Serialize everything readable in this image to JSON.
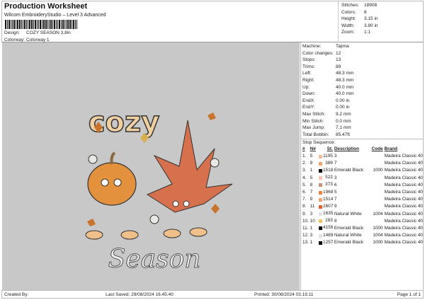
{
  "header": {
    "title": "Production Worksheet",
    "subtitle": "Wilcom EmbroideryStudio – Level 3 Advanced",
    "design_label": "Design:",
    "design_value": "COZY SEASON 3,8in",
    "colorway_label": "Colorway:",
    "colorway_value": "Colorway 1"
  },
  "stats": [
    {
      "k": "Stitches:",
      "v": "18908"
    },
    {
      "k": "Colors:",
      "v": "8"
    },
    {
      "k": "Height:",
      "v": "3.15 in"
    },
    {
      "k": "Width:",
      "v": "3.80 in"
    },
    {
      "k": "Zoom:",
      "v": "1:1"
    }
  ],
  "artwork": {
    "top_text": "cozy",
    "bottom_text": "Season"
  },
  "properties": [
    {
      "k": "Machine:",
      "v": "Tajima"
    },
    {
      "k": "Color changes:",
      "v": "12"
    },
    {
      "k": "Stops:",
      "v": "13"
    },
    {
      "k": "Trims:",
      "v": "89"
    },
    {
      "k": "Left:",
      "v": "48.3 mm"
    },
    {
      "k": "Right:",
      "v": "48.3 mm"
    },
    {
      "k": "Up:",
      "v": "40.0 mm"
    },
    {
      "k": "Down:",
      "v": "40.0 mm"
    },
    {
      "k": "EndX:",
      "v": "0.00 in"
    },
    {
      "k": "EndY:",
      "v": "0.00 in"
    },
    {
      "k": "Max Stitch:",
      "v": "9.2 mm"
    },
    {
      "k": "Min Stitch:",
      "v": "0.0 mm"
    },
    {
      "k": "Max Jump:",
      "v": "7.1 mm"
    },
    {
      "k": "Total Bobbin:",
      "v": "85.47ft"
    }
  ],
  "stop_sequence_label": "Stop Sequence:",
  "columns": [
    "#",
    "N#",
    "St.",
    "Description",
    "Code",
    "Brand"
  ],
  "stops": [
    {
      "n": "1.",
      "nn": "5",
      "color": "#f2bc9c",
      "st": "1195",
      "desc": "3",
      "code": "",
      "brand": "Madeira Classic 40"
    },
    {
      "n": "2.",
      "nn": "9",
      "color": "#f0a474",
      "st": "389",
      "desc": "7",
      "code": "",
      "brand": "Madeira Classic 40"
    },
    {
      "n": "3.",
      "nn": "1",
      "color": "#000000",
      "st": "1518",
      "desc": "Emerald Black",
      "code": "1000",
      "brand": "Madeira Classic 40"
    },
    {
      "n": "4.",
      "nn": "5",
      "color": "#f4c4ac",
      "st": "522",
      "desc": "3",
      "code": "",
      "brand": "Madeira Classic 40"
    },
    {
      "n": "5.",
      "nn": "8",
      "color": "#c8907a",
      "st": "373",
      "desc": "6",
      "code": "",
      "brand": "Madeira Classic 40"
    },
    {
      "n": "6.",
      "nn": "7",
      "color": "#ec8440",
      "st": "1968",
      "desc": "5",
      "code": "",
      "brand": "Madeira Classic 40"
    },
    {
      "n": "7.",
      "nn": "9",
      "color": "#f0a474",
      "st": "1514",
      "desc": "7",
      "code": "",
      "brand": "Madeira Classic 40"
    },
    {
      "n": "8.",
      "nn": "11",
      "color": "#e06034",
      "st": "2607",
      "desc": "9",
      "code": "",
      "brand": "Madeira Classic 40"
    },
    {
      "n": "9.",
      "nn": "3",
      "color": "#e2e2ea",
      "st": "1635",
      "desc": "Natural White",
      "code": "1004",
      "brand": "Madeira Classic 40"
    },
    {
      "n": "10.",
      "nn": "10",
      "color": "#f0c464",
      "st": "283",
      "desc": "8",
      "code": "",
      "brand": "Madeira Classic 40"
    },
    {
      "n": "11.",
      "nn": "1",
      "color": "#000000",
      "st": "4156",
      "desc": "Emerald Black",
      "code": "1000",
      "brand": "Madeira Classic 40"
    },
    {
      "n": "12.",
      "nn": "3",
      "color": "#e2e2ea",
      "st": "1489",
      "desc": "Natural White",
      "code": "1004",
      "brand": "Madeira Classic 40"
    },
    {
      "n": "13.",
      "nn": "1",
      "color": "#000000",
      "st": "1257",
      "desc": "Emerald Black",
      "code": "1000",
      "brand": "Madeira Classic 40"
    }
  ],
  "footer": {
    "created": "Created By:",
    "saved": "Last Saved: 29/08/2024 16.45.40",
    "printed": "Printed: 30/08/2024 03.19.11",
    "page": "Page 1 of 1"
  }
}
